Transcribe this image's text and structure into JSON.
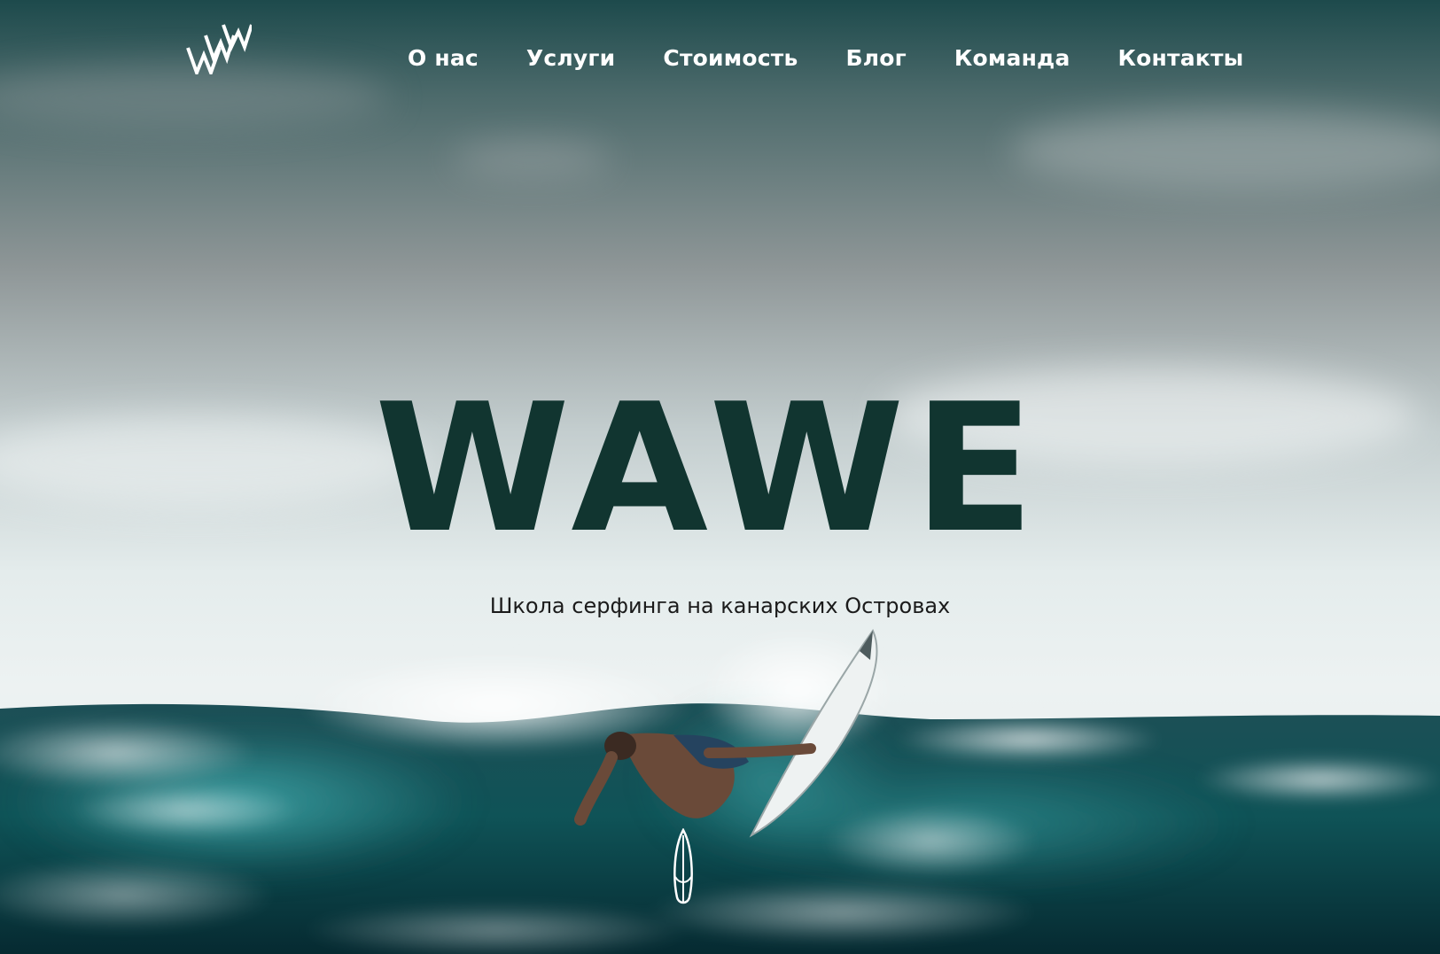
{
  "header": {
    "logo_icon": "wawe-logo-icon",
    "nav": [
      "О нас",
      "Услуги",
      "Стоимость",
      "Блог",
      "Команда",
      "Контакты"
    ]
  },
  "hero": {
    "title": "WAWE",
    "subtitle": "Школа серфинга на канарских Островах",
    "scroll_icon": "surfboard-icon"
  },
  "colors": {
    "title": "#113530",
    "nav_text": "#ffffff",
    "subtitle": "#1b1b1b",
    "sky_top": "#1d4a4c",
    "ocean": "#0f5357"
  }
}
